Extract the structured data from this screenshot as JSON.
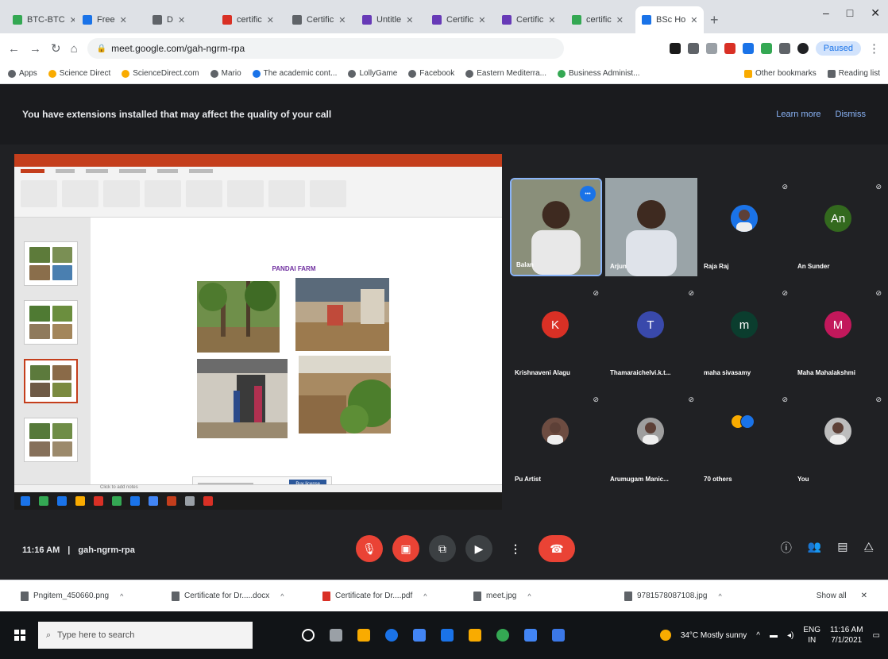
{
  "browser": {
    "tabs": [
      {
        "label": "BTC-BTC",
        "color": "#34a853",
        "active": false
      },
      {
        "label": "Free",
        "color": "#1a73e8",
        "active": false
      },
      {
        "label": "D",
        "color": "#5f6368",
        "active": false
      },
      {
        "label": "certific",
        "color": "#d93025",
        "active": false
      },
      {
        "label": "Certific",
        "color": "#5f6368",
        "active": false
      },
      {
        "label": "Untitle",
        "color": "#673ab7",
        "active": false
      },
      {
        "label": "Certific",
        "color": "#673ab7",
        "active": false
      },
      {
        "label": "Certific",
        "color": "#673ab7",
        "active": false
      },
      {
        "label": "certific",
        "color": "#34a853",
        "active": false
      },
      {
        "label": "BSc Ho",
        "color": "#1a73e8",
        "active": true
      }
    ],
    "new_tab": "+",
    "window_controls": [
      "–",
      "□",
      "✕"
    ],
    "url": "meet.google.com/gah-ngrm-rpa",
    "profile": "Paused",
    "bookmarks": [
      {
        "label": "Apps",
        "color": "#5f6368"
      },
      {
        "label": "Science Direct",
        "color": "#f9ab00"
      },
      {
        "label": "ScienceDirect.com",
        "color": "#f9ab00"
      },
      {
        "label": "Mario",
        "color": "#5f6368"
      },
      {
        "label": "The academic cont...",
        "color": "#1a73e8"
      },
      {
        "label": "LollyGame",
        "color": "#5f6368"
      },
      {
        "label": "Facebook",
        "color": "#5f6368"
      },
      {
        "label": "Eastern Mediterra...",
        "color": "#5f6368"
      },
      {
        "label": "Business Administ...",
        "color": "#34a853"
      }
    ],
    "other_bookmarks": "Other bookmarks",
    "reading_list": "Reading list"
  },
  "meet": {
    "warning": {
      "text": "You have extensions installed that may affect the quality of your call",
      "learn_more": "Learn more",
      "dismiss": "Dismiss"
    },
    "presentation": {
      "slide_title": "PANDAI FARM",
      "notification_button": "Buy license",
      "status": "Click to add notes"
    },
    "participants": [
      {
        "name": "Balan",
        "avatar": "photo",
        "color": "#8d6e63",
        "initial": ""
      },
      {
        "name": "Arjun",
        "avatar": "photo",
        "color": "#795548",
        "initial": ""
      },
      {
        "name": "Raja Raj",
        "avatar": "photo",
        "color": "#1a73e8",
        "initial": ""
      },
      {
        "name": "An Sunder",
        "avatar": "initial",
        "color": "#33691e",
        "initial": "An"
      },
      {
        "name": "Krishnaveni Alagu",
        "avatar": "initial",
        "color": "#d93025",
        "initial": "K"
      },
      {
        "name": "Thamaraichelvi.k.t...",
        "avatar": "initial",
        "color": "#3949ab",
        "initial": "T"
      },
      {
        "name": "maha sivasamy",
        "avatar": "initial",
        "color": "#0b3d2e",
        "initial": "m"
      },
      {
        "name": "Maha Mahalakshmi",
        "avatar": "initial",
        "color": "#c2185b",
        "initial": "M"
      },
      {
        "name": "Pu Artist",
        "avatar": "photo",
        "color": "#6d4c41",
        "initial": ""
      },
      {
        "name": "Arumugam Manic...",
        "avatar": "photo",
        "color": "#9e9e9e",
        "initial": ""
      },
      {
        "name": "70 others",
        "avatar": "others",
        "color": "#f9ab00",
        "initial": ""
      },
      {
        "name": "You",
        "avatar": "photo",
        "color": "#bdbdbd",
        "initial": ""
      }
    ],
    "time": "11:16 AM",
    "separator": "|",
    "meeting_code": "gah-ngrm-rpa"
  },
  "downloads": {
    "items": [
      {
        "name": "Pngitem_450660.png",
        "type": "png"
      },
      {
        "name": "Certificate for Dr.....docx",
        "type": "doc"
      },
      {
        "name": "Certificate for Dr....pdf",
        "type": "pdf"
      },
      {
        "name": "meet.jpg",
        "type": "jpg"
      },
      {
        "name": "9781578087108.jpg",
        "type": "jpg"
      }
    ],
    "show_all": "Show all",
    "close": "✕"
  },
  "taskbar": {
    "search_placeholder": "Type here to search",
    "weather": "34°C  Mostly sunny",
    "lang": "ENG",
    "region": "IN",
    "time": "11:16 AM",
    "date": "7/1/2021"
  }
}
